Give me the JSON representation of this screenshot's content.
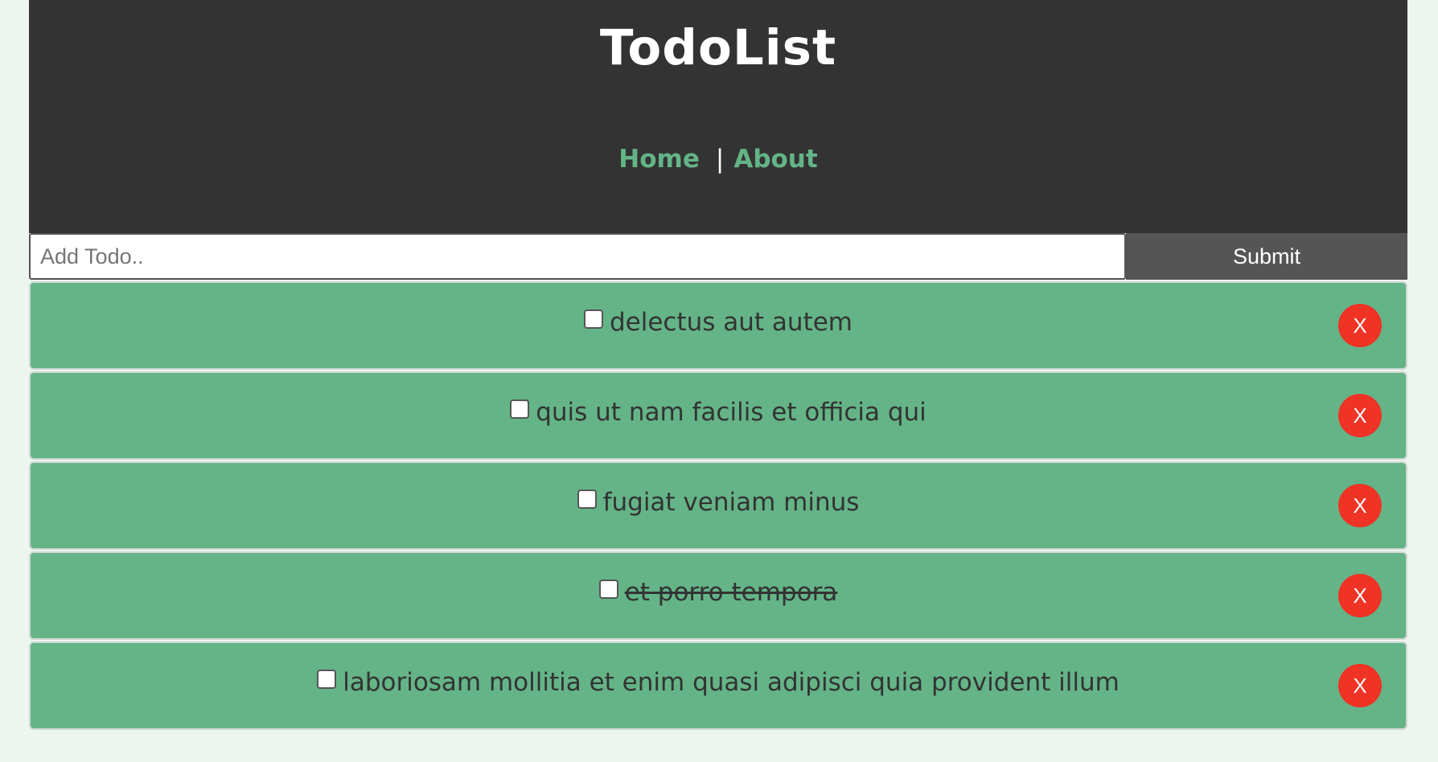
{
  "header": {
    "title": "TodoList",
    "nav": {
      "home": "Home",
      "separator": "|",
      "about": "About"
    }
  },
  "form": {
    "placeholder": "Add Todo..",
    "submit_label": "Submit"
  },
  "todos": [
    {
      "title": "delectus aut autem",
      "completed": false,
      "delete_label": "X"
    },
    {
      "title": "quis ut nam facilis et officia qui",
      "completed": false,
      "delete_label": "X"
    },
    {
      "title": "fugiat veniam minus",
      "completed": false,
      "delete_label": "X"
    },
    {
      "title": "et porro tempora",
      "completed": true,
      "delete_label": "X"
    },
    {
      "title": "laboriosam mollitia et enim quasi adipisci quia provident illum",
      "completed": false,
      "delete_label": "X"
    }
  ],
  "colors": {
    "header_bg": "#333333",
    "accent": "#64b487",
    "delete": "#ef3325",
    "submit_bg": "#555555"
  }
}
